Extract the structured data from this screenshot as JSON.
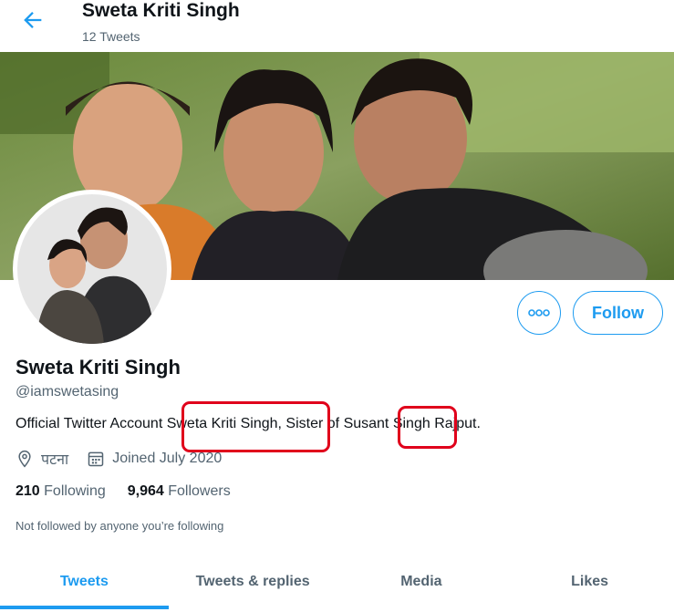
{
  "header": {
    "title": "Sweta Kriti Singh",
    "tweet_count": "12 Tweets"
  },
  "profile": {
    "name": "Sweta Kriti Singh",
    "handle": "@iamswetasing",
    "bio_part1": "Official Twitter Account Sweta Kriti Singh, Sister of ",
    "bio_part2": "Susant",
    "bio_part3": " Singh Rajput.",
    "location": "पटना",
    "joined": "Joined July 2020",
    "following_count": "210",
    "following_label": "Following",
    "followers_count": "9,964",
    "followers_label": "Followers",
    "not_followed": "Not followed by anyone you’re following"
  },
  "actions": {
    "follow_label": "Follow"
  },
  "tabs": [
    {
      "label": "Tweets",
      "active": true
    },
    {
      "label": "Tweets & replies",
      "active": false
    },
    {
      "label": "Media",
      "active": false
    },
    {
      "label": "Likes",
      "active": false
    }
  ],
  "colors": {
    "accent": "#1d9bf0",
    "annotation": "#e0001b"
  },
  "icons": [
    "back-arrow-icon",
    "more-icon",
    "location-icon",
    "calendar-icon"
  ]
}
